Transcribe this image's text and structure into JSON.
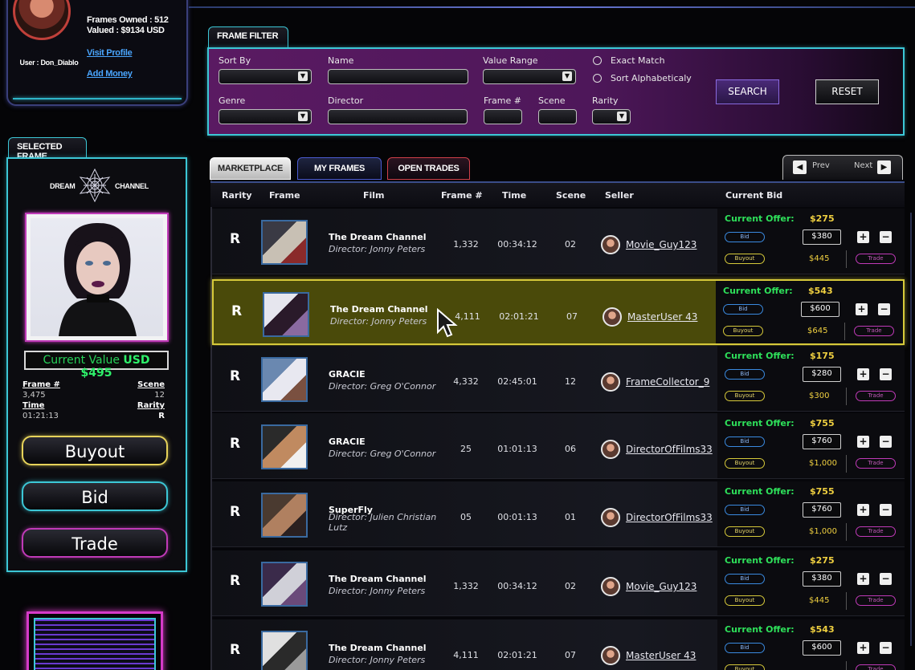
{
  "profile": {
    "user_label": "User : Don_Diablo",
    "frames_owned": "Frames Owned : 512",
    "valued": "Valued : $9134 USD",
    "visit_profile": "Visit Profile",
    "add_money": "Add Money"
  },
  "selected_frame": {
    "tab_label": "SELECTED FRAME",
    "logo_left": "DREAM",
    "logo_right": "CHANNEL",
    "current_value_label": "Current Value",
    "current_value_amount": "USD $495",
    "frame_label": "Frame #",
    "frame_value": "3,475",
    "scene_label": "Scene",
    "scene_value": "12",
    "time_label": "Time",
    "time_value": "01:21:13",
    "rarity_label": "Rarity",
    "rarity_value": "R",
    "buyout_label": "Buyout",
    "bid_label": "Bid",
    "trade_label": "Trade"
  },
  "filter": {
    "tab_label": "FRAME FILTER",
    "sort_by_label": "Sort By",
    "name_label": "Name",
    "value_range_label": "Value Range",
    "exact_match_label": "Exact Match",
    "sort_alpha_label": "Sort Alphabeticaly",
    "genre_label": "Genre",
    "director_label": "Director",
    "frame_label": "Frame #",
    "scene_label": "Scene",
    "rarity_label": "Rarity",
    "search_label": "SEARCH",
    "reset_label": "RESET"
  },
  "tabs": [
    {
      "label": "MARKETPLACE"
    },
    {
      "label": "MY FRAMES"
    },
    {
      "label": "OPEN TRADES"
    }
  ],
  "pager": {
    "prev": "Prev",
    "next": "Next"
  },
  "table": {
    "headers": [
      "Rarity",
      "Frame",
      "Film",
      "Frame #",
      "Time",
      "Scene",
      "Seller",
      "Current Bid"
    ],
    "offer_label": "Current Offer:",
    "bid_pill": "Bid",
    "buyout_pill": "Buyout",
    "trade_pill": "Trade",
    "plus": "+",
    "minus": "−",
    "rows": [
      {
        "rarity": "R",
        "film": "The Dream Channel",
        "director": "Director: Jonny Peters",
        "frame": "1,332",
        "time": "00:34:12",
        "scene": "02",
        "seller": "Movie_Guy123",
        "offer": "$275",
        "bid": "$380",
        "buyout": "$445"
      },
      {
        "rarity": "R",
        "film": "The Dream Channel",
        "director": "Director: Jonny Peters",
        "frame": "4,111",
        "time": "02:01:21",
        "scene": "07",
        "seller": "MasterUser 43",
        "offer": "$543",
        "bid": "$600",
        "buyout": "$645"
      },
      {
        "rarity": "R",
        "film": "GRACIE",
        "director": "Director: Greg O'Connor",
        "frame": "4,332",
        "time": "02:45:01",
        "scene": "12",
        "seller": "FrameCollector_9",
        "offer": "$175",
        "bid": "$280",
        "buyout": "$300"
      },
      {
        "rarity": "R",
        "film": "GRACIE",
        "director": "Director: Greg O'Connor",
        "frame": "25",
        "time": "01:01:13",
        "scene": "06",
        "seller": "DirectorOfFilms33",
        "offer": "$755",
        "bid": "$760",
        "buyout": "$1,000"
      },
      {
        "rarity": "R",
        "film": "SuperFly",
        "director": "Director: Julien Christian Lutz",
        "frame": "05",
        "time": "00:01:13",
        "scene": "01",
        "seller": "DirectorOfFilms33",
        "offer": "$755",
        "bid": "$760",
        "buyout": "$1,000"
      },
      {
        "rarity": "R",
        "film": "The Dream Channel",
        "director": "Director: Jonny Peters",
        "frame": "1,332",
        "time": "00:34:12",
        "scene": "02",
        "seller": "Movie_Guy123",
        "offer": "$275",
        "bid": "$380",
        "buyout": "$445"
      },
      {
        "rarity": "R",
        "film": "The Dream Channel",
        "director": "Director: Jonny Peters",
        "frame": "4,111",
        "time": "02:01:21",
        "scene": "07",
        "seller": "MasterUser 43",
        "offer": "$543",
        "bid": "$600",
        "buyout": ""
      }
    ]
  },
  "colors": {
    "accent_cyan": "#3cc7d6",
    "accent_magenta": "#c03ab8",
    "accent_yellow": "#d6c93a",
    "offer_green": "#2ee05a"
  }
}
